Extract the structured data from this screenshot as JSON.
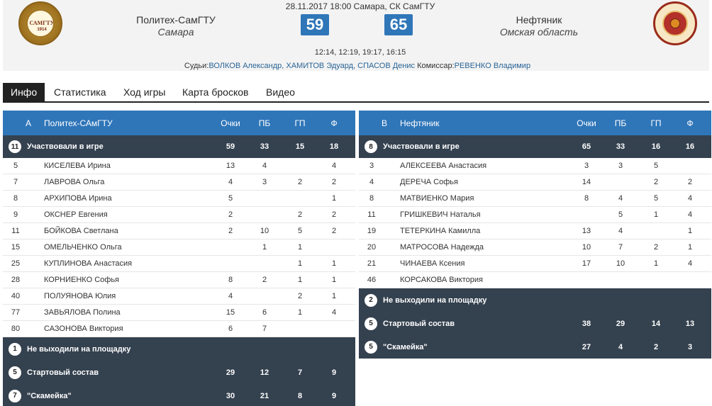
{
  "header": {
    "game_info": "28.11.2017 18:00 Самара, СК СамГТУ",
    "home": {
      "name": "Политех-СамГТУ",
      "city": "Самара",
      "score": "59",
      "logo_text": "САМГТУ",
      "logo_year": "1914"
    },
    "away": {
      "name": "Нефтяник",
      "city": "Омская область",
      "score": "65"
    },
    "quarters": "12:14, 12:19, 19:17, 16:15",
    "referees_label": "Судьи:",
    "referees": "ВОЛКОВ Александр, ХАМИТОВ Эдуард, СПАСОВ Денис",
    "commissioner_label": "Комиссар:",
    "commissioner": "РЕВЕНКО Владимир"
  },
  "tabs": [
    {
      "label": "Инфо",
      "active": true
    },
    {
      "label": "Статистика"
    },
    {
      "label": "Ход игры"
    },
    {
      "label": "Карта бросков"
    },
    {
      "label": "Видео"
    }
  ],
  "columns": {
    "pts": "Очки",
    "reb": "ПБ",
    "ast": "ГП",
    "fls": "Ф"
  },
  "home_table": {
    "letter": "А",
    "team": "Политех-САмГТУ",
    "played": {
      "count": "11",
      "label": "Участвовали в игре",
      "pts": "59",
      "reb": "33",
      "ast": "15",
      "fls": "18"
    },
    "players": [
      {
        "num": "5",
        "name": "КИСЕЛЕВА Ирина",
        "pts": "13",
        "reb": "4",
        "ast": "",
        "fls": "4"
      },
      {
        "num": "7",
        "name": "ЛАВРОВА Ольга",
        "pts": "4",
        "reb": "3",
        "ast": "2",
        "fls": "2"
      },
      {
        "num": "8",
        "name": "АРХИПОВА Ирина",
        "pts": "5",
        "reb": "",
        "ast": "",
        "fls": "1"
      },
      {
        "num": "9",
        "name": "ОКСНЕР Евгения",
        "pts": "2",
        "reb": "",
        "ast": "2",
        "fls": "2"
      },
      {
        "num": "11",
        "name": "БОЙКОВА Светлана",
        "pts": "2",
        "reb": "10",
        "ast": "5",
        "fls": "2"
      },
      {
        "num": "15",
        "name": "ОМЕЛЬЧЕНКО Ольга",
        "pts": "",
        "reb": "1",
        "ast": "1",
        "fls": ""
      },
      {
        "num": "25",
        "name": "КУПЛИНОВА Анастасия",
        "pts": "",
        "reb": "",
        "ast": "1",
        "fls": "1"
      },
      {
        "num": "28",
        "name": "КОРНИЕНКО Софья",
        "pts": "8",
        "reb": "2",
        "ast": "1",
        "fls": "1"
      },
      {
        "num": "40",
        "name": "ПОЛУЯНОВА Юлия",
        "pts": "4",
        "reb": "",
        "ast": "2",
        "fls": "1"
      },
      {
        "num": "77",
        "name": "ЗАВЬЯЛОВА Полина",
        "pts": "15",
        "reb": "6",
        "ast": "1",
        "fls": "4"
      },
      {
        "num": "80",
        "name": "САЗОНОВА Виктория",
        "pts": "6",
        "reb": "7",
        "ast": "",
        "fls": ""
      }
    ],
    "not_played": {
      "count": "1",
      "label": "Не выходили на площадку"
    },
    "starters": {
      "count": "5",
      "label": "Стартовый состав",
      "pts": "29",
      "reb": "12",
      "ast": "7",
      "fls": "9"
    },
    "bench": {
      "count": "7",
      "label": "\"Скамейка\"",
      "pts": "30",
      "reb": "21",
      "ast": "8",
      "fls": "9"
    }
  },
  "away_table": {
    "letter": "В",
    "team": "Нефтяник",
    "played": {
      "count": "8",
      "label": "Участвовали в игре",
      "pts": "65",
      "reb": "33",
      "ast": "16",
      "fls": "16"
    },
    "players": [
      {
        "num": "3",
        "name": "АЛЕКСЕЕВА Анастасия",
        "pts": "3",
        "reb": "3",
        "ast": "5",
        "fls": ""
      },
      {
        "num": "4",
        "name": "ДЕРЕЧА Софья",
        "pts": "14",
        "reb": "",
        "ast": "2",
        "fls": "2"
      },
      {
        "num": "8",
        "name": "МАТВИЕНКО Мария",
        "pts": "8",
        "reb": "4",
        "ast": "5",
        "fls": "4"
      },
      {
        "num": "11",
        "name": "ГРИШКЕВИЧ Наталья",
        "pts": "",
        "reb": "5",
        "ast": "1",
        "fls": "4"
      },
      {
        "num": "19",
        "name": "ТЕТЕРКИНА Камилла",
        "pts": "13",
        "reb": "4",
        "ast": "",
        "fls": "1"
      },
      {
        "num": "20",
        "name": "МАТРОСОВА Надежда",
        "pts": "10",
        "reb": "7",
        "ast": "2",
        "fls": "1"
      },
      {
        "num": "21",
        "name": "ЧИНАЕВА Ксения",
        "pts": "17",
        "reb": "10",
        "ast": "1",
        "fls": "4"
      },
      {
        "num": "46",
        "name": "КОРСАКОВА Виктория",
        "pts": "",
        "reb": "",
        "ast": "",
        "fls": ""
      }
    ],
    "not_played": {
      "count": "2",
      "label": "Не выходили на площадку"
    },
    "starters": {
      "count": "5",
      "label": "Стартовый состав",
      "pts": "38",
      "reb": "29",
      "ast": "14",
      "fls": "13"
    },
    "bench": {
      "count": "5",
      "label": "\"Скамейка\"",
      "pts": "27",
      "reb": "4",
      "ast": "2",
      "fls": "3"
    }
  },
  "colors": {
    "primary_blue": "#2f76b9",
    "dark_row": "#34414f",
    "tab_active": "#222222",
    "link": "#2a6496"
  }
}
